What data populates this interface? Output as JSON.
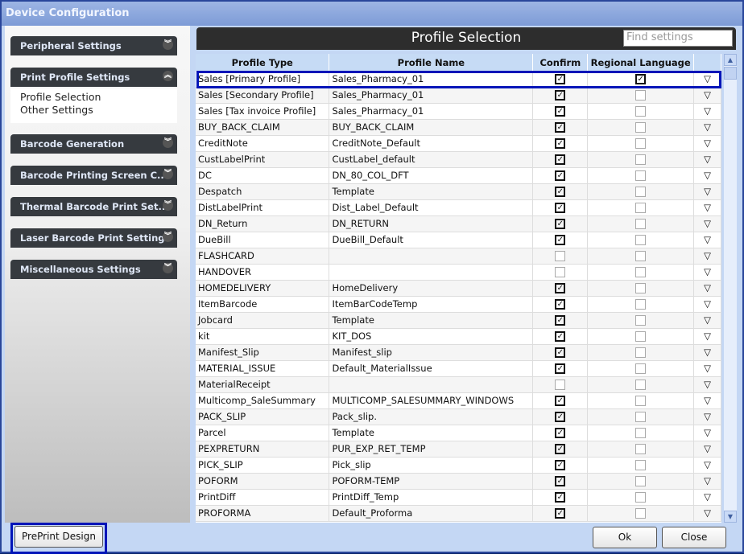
{
  "window": {
    "title": "Device Configuration"
  },
  "sidebar": {
    "sections": [
      {
        "label": "Peripheral Settings",
        "icon": "chevron-double-down-icon"
      },
      {
        "label": "Print Profile Settings",
        "icon": "chevron-double-up-icon",
        "expanded": true,
        "items": [
          "Profile Selection",
          "Other Settings"
        ]
      },
      {
        "label": "Barcode Generation",
        "icon": "chevron-double-down-icon"
      },
      {
        "label": "Barcode Printing Screen C...",
        "icon": "chevron-double-down-icon"
      },
      {
        "label": "Thermal Barcode Print Set...",
        "icon": "chevron-double-down-icon"
      },
      {
        "label": "Laser Barcode Print Settings",
        "icon": "chevron-double-down-icon"
      },
      {
        "label": "Miscellaneous Settings",
        "icon": "chevron-double-down-icon"
      }
    ]
  },
  "main": {
    "title": "Profile Selection",
    "search_placeholder": "Find settings",
    "columns": [
      "Profile Type",
      "Profile Name",
      "Confirm",
      "Regional Language",
      ""
    ],
    "rows": [
      [
        "Sales [Primary Profile]",
        "Sales_Pharmacy_01",
        true,
        true
      ],
      [
        "Sales [Secondary Profile]",
        "Sales_Pharmacy_01",
        true,
        false
      ],
      [
        "Sales [Tax invoice Profile]",
        "Sales_Pharmacy_01",
        true,
        false
      ],
      [
        "BUY_BACK_CLAIM",
        "BUY_BACK_CLAIM",
        true,
        false
      ],
      [
        "CreditNote",
        "CreditNote_Default",
        true,
        false
      ],
      [
        "CustLabelPrint",
        "CustLabel_default",
        true,
        false
      ],
      [
        "DC",
        "DN_80_COL_DFT",
        true,
        false
      ],
      [
        "Despatch",
        "Template",
        true,
        false
      ],
      [
        "DistLabelPrint",
        "Dist_Label_Default",
        true,
        false
      ],
      [
        "DN_Return",
        "DN_RETURN",
        true,
        false
      ],
      [
        "DueBill",
        "DueBill_Default",
        true,
        false
      ],
      [
        "FLASHCARD",
        "",
        false,
        false
      ],
      [
        "HANDOVER",
        "",
        false,
        false
      ],
      [
        "HOMEDELIVERY",
        "HomeDelivery",
        true,
        false
      ],
      [
        "ItemBarcode",
        "ItemBarCodeTemp",
        true,
        false
      ],
      [
        "Jobcard",
        "Template",
        true,
        false
      ],
      [
        "kit",
        "KIT_DOS",
        true,
        false
      ],
      [
        "Manifest_Slip",
        "Manifest_slip",
        true,
        false
      ],
      [
        "MATERIAL_ISSUE",
        "Default_MaterialIssue",
        true,
        false
      ],
      [
        "MaterialReceipt",
        "",
        false,
        false
      ],
      [
        "Multicomp_SaleSummary",
        "MULTICOMP_SALESUMMARY_WINDOWS",
        true,
        false
      ],
      [
        "PACK_SLIP",
        "Pack_slip.",
        true,
        false
      ],
      [
        "Parcel",
        "Template",
        true,
        false
      ],
      [
        "PEXPRETURN",
        "PUR_EXP_RET_TEMP",
        true,
        false
      ],
      [
        "PICK_SLIP",
        "Pick_slip",
        true,
        false
      ],
      [
        "POFORM",
        "POFORM-TEMP",
        true,
        false
      ],
      [
        "PrintDiff",
        "PrintDiff_Temp",
        true,
        false
      ],
      [
        "PROFORMA",
        "Default_Proforma",
        true,
        false
      ]
    ]
  },
  "footer": {
    "preprint": "PrePrint Design",
    "ok": "Ok",
    "close": "Close"
  }
}
